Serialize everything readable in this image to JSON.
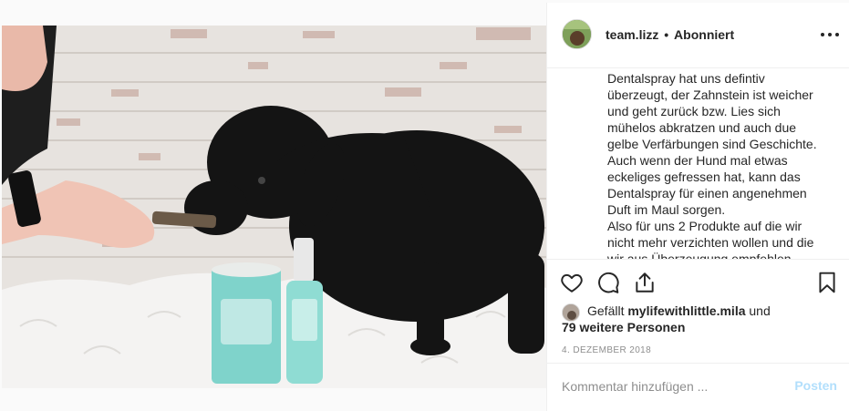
{
  "post": {
    "username": "team.lizz",
    "separator": "•",
    "follow_state": "Abonniert",
    "caption_lines": [
      "Dentalspray hat uns defintiv",
      "überzeugt, der Zahnstein ist weicher",
      "und geht zurück bzw. Lies sich",
      "mühelos abkratzen und auch due",
      "gelbe Verfärbungen sind Geschichte.",
      "Auch wenn der Hund mal etwas",
      "eckeliges gefressen hat, kann das",
      "Dentalspray für einen angenehmen",
      "Duft im Maul sorgen.",
      "Also für uns 2 Produkte auf die wir",
      "nicht mehr verzichten wollen und die",
      "wir aus Überzeugung empfehlen."
    ],
    "likes": {
      "prefix": "Gefällt",
      "liker": "mylifewithlittle.mila",
      "conjunction": "und",
      "others": "79 weitere Personen"
    },
    "date": "4. Dezember 2018"
  },
  "icons": {
    "avatar": "avatar",
    "more": "more-options-icon",
    "like": "heart-icon",
    "comment": "comment-icon",
    "share": "share-icon",
    "save": "bookmark-icon"
  },
  "comment": {
    "placeholder": "Kommentar hinzufügen ...",
    "post_label": "Posten"
  },
  "colors": {
    "text": "#262626",
    "muted": "#8e8e8e",
    "border": "#efefef",
    "post_button_disabled": "#b2dffc",
    "product_teal": "#7fd3cb"
  }
}
